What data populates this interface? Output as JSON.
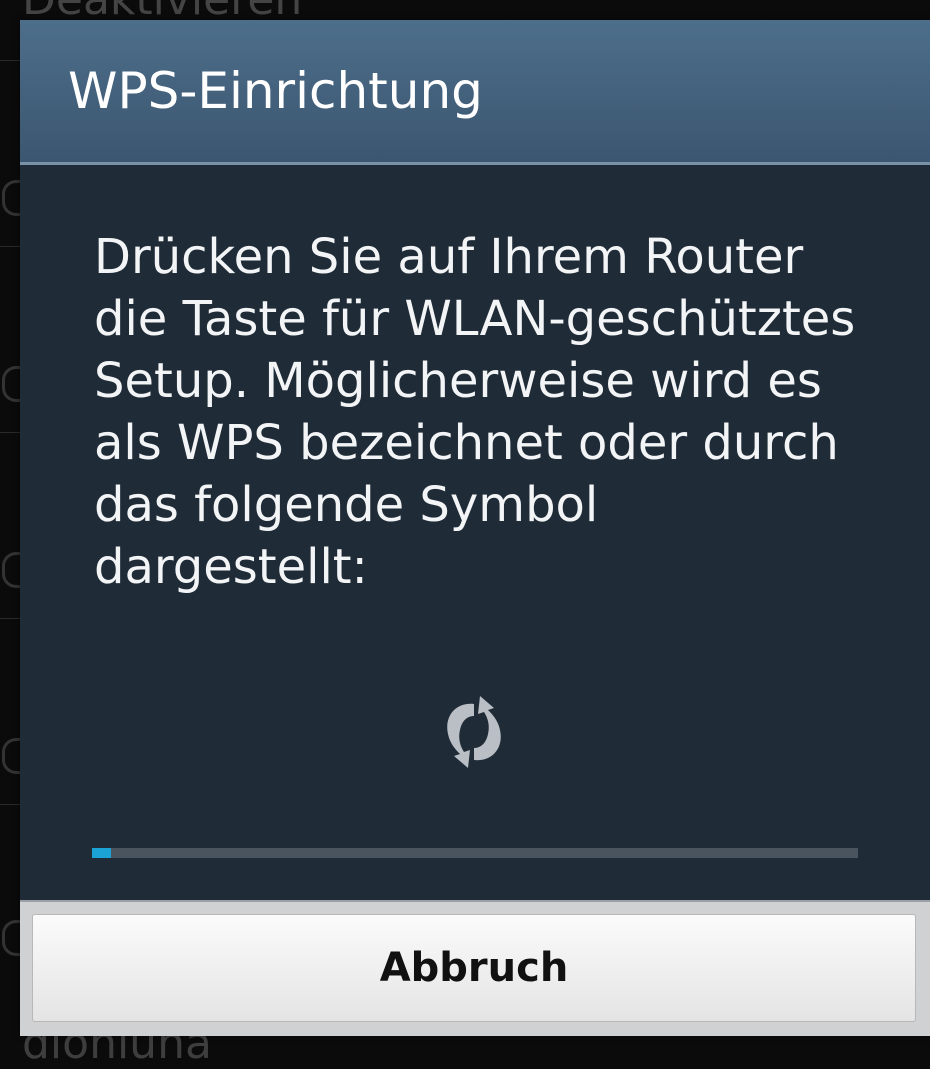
{
  "background": {
    "top_text": "Deaktivieren",
    "bottom_text": "dlonluna"
  },
  "dialog": {
    "title": "WPS-Einrichtung",
    "message": "Drücken Sie auf Ihrem Router die Taste für WLAN-geschütztes Setup. Möglicherweise wird es als WPS bezeichnet oder durch das folgende Symbol dargestellt:",
    "icon": "wps-icon",
    "progress_fraction": 0.025,
    "cancel_label": "Abbruch"
  },
  "colors": {
    "header": "#4d6e8a",
    "body": "#1f2b37",
    "progress": "#1aa3d4"
  }
}
